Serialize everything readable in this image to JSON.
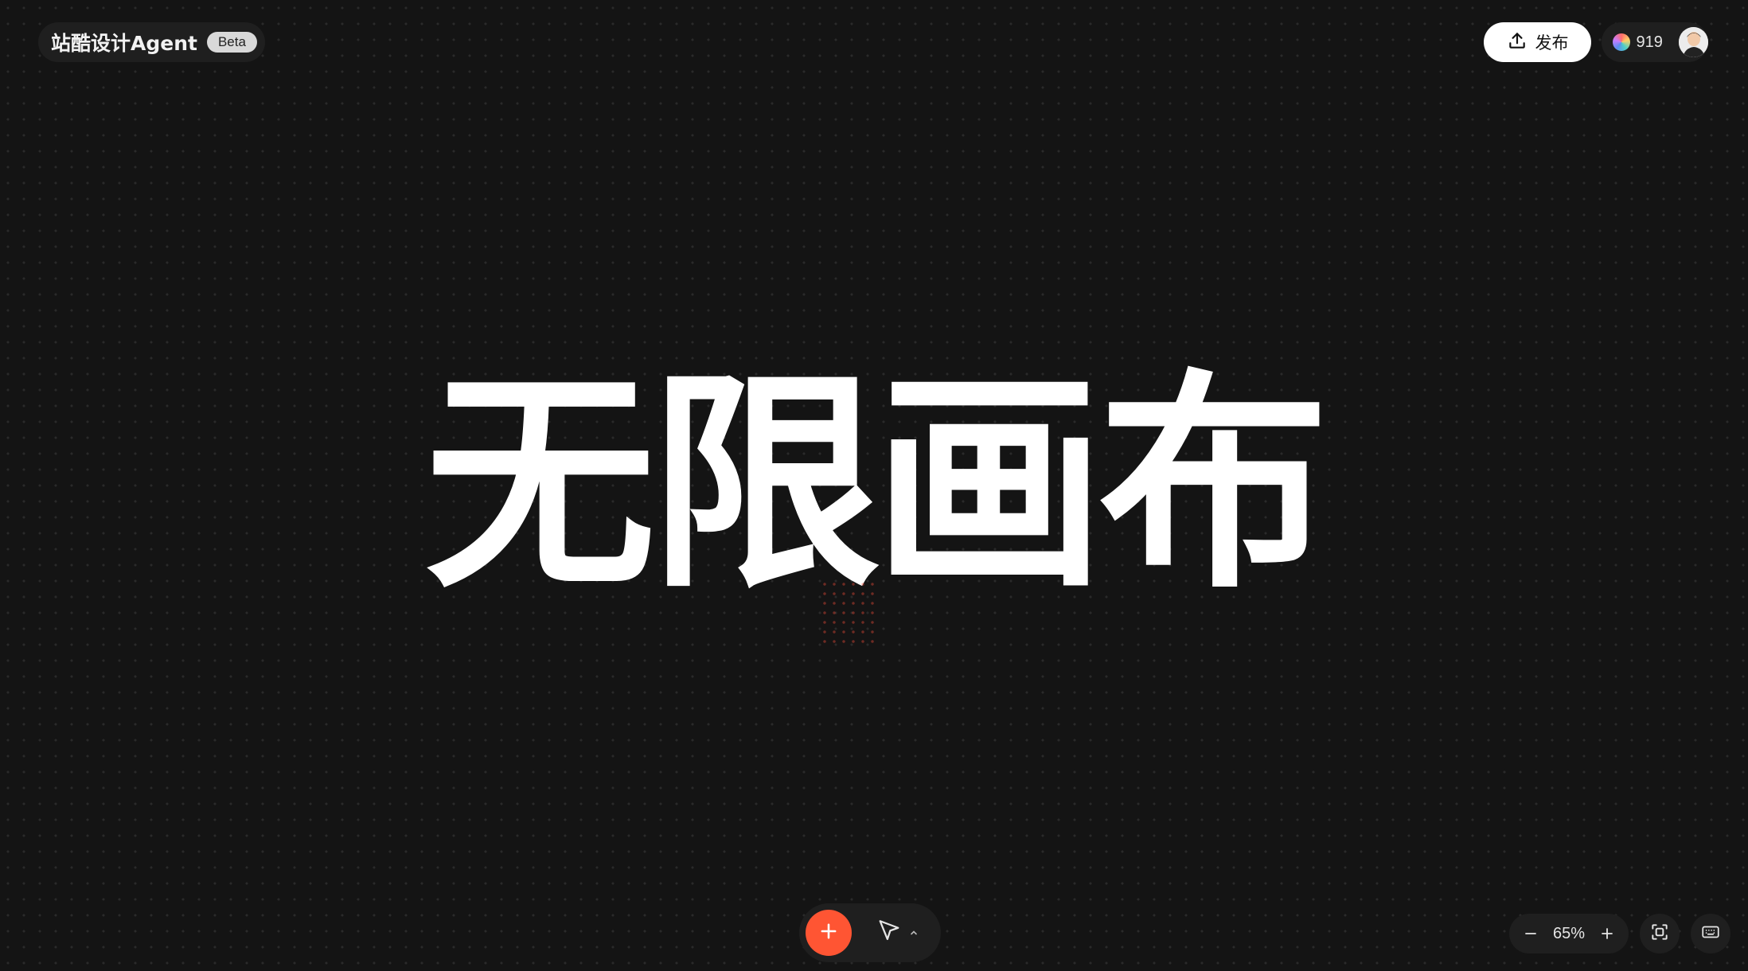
{
  "brand": {
    "name": "站酷设计Agent",
    "badge": "Beta"
  },
  "header": {
    "publish_label": "发布",
    "credits": "919",
    "coin_icon": "credits-coin-icon",
    "avatar_icon": "user-avatar"
  },
  "canvas": {
    "headline": "无限画布"
  },
  "toolbar": {
    "add_icon": "plus-icon",
    "select_icon": "cursor-arrow-icon",
    "expand_icon": "chevron-up-icon",
    "accent_color": "#ff5533"
  },
  "zoom": {
    "value": "65%",
    "zoom_out_icon": "minus-icon",
    "zoom_in_icon": "plus-icon",
    "fit_icon": "fit-screen-icon",
    "keyboard_icon": "keyboard-icon"
  }
}
